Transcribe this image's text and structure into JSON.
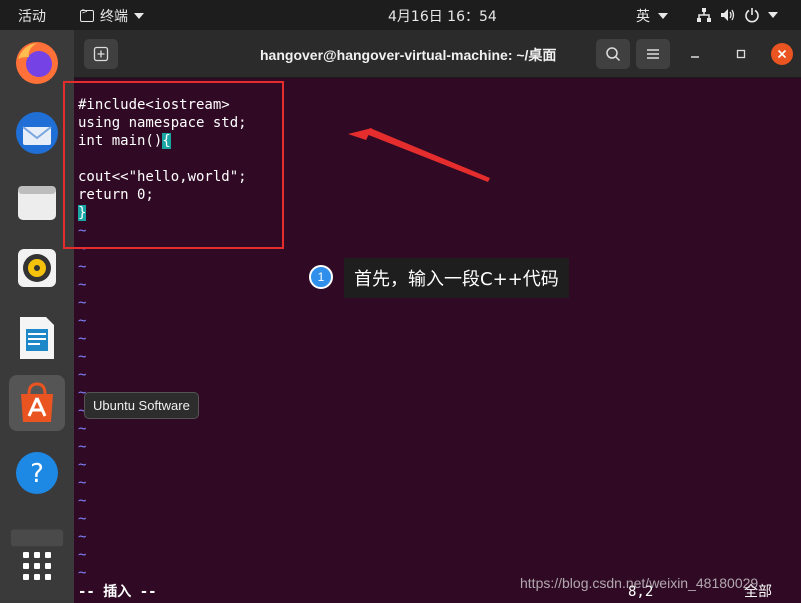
{
  "top_panel": {
    "activities": "活动",
    "app_name": "终端",
    "clock": "4月16日  16：54",
    "input_method": "英"
  },
  "dock": {
    "items": [
      "firefox-icon",
      "thunderbird-icon",
      "files-icon",
      "rhythmbox-icon",
      "libreoffice-writer-icon",
      "ubuntu-software-icon",
      "help-icon",
      "show-apps-icon"
    ],
    "tooltip": "Ubuntu Software"
  },
  "terminal": {
    "title": "hangover@hangover-virtual-machine: ~/桌面",
    "code_lines": {
      "l1": "#include<iostream>",
      "l2": "using namespace std;",
      "l3_pre": "int main()",
      "l3_brace": "{",
      "l4": "",
      "l5": "cout<<\"hello,world\";",
      "l6": "return 0;",
      "l7_brace": "}"
    },
    "tildes": "~",
    "status_mode": "-- 插入 --",
    "status_position": "8,2",
    "status_scroll": "全部"
  },
  "annotation": {
    "step_number": "1",
    "step_text": "首先，输入一段C++代码",
    "box_color": "#e52d2d",
    "badge_color": "#2f8fea"
  },
  "watermark": "https://blog.csdn.net/weixin_48180029",
  "colors": {
    "terminal_bg": "#300a24",
    "accent": "#e95420",
    "tilde": "#7f82ff",
    "cursor": "#1aa5a5"
  }
}
